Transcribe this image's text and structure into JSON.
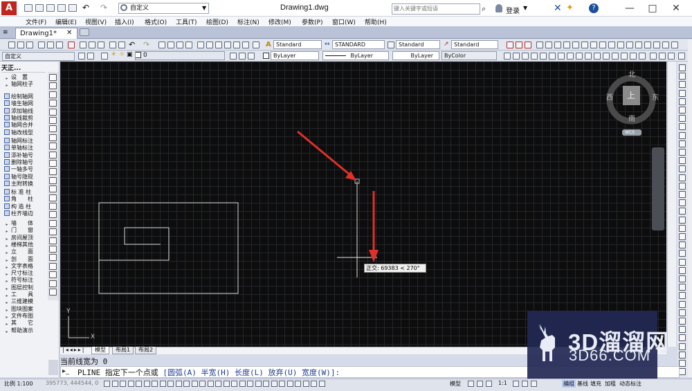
{
  "titlebar": {
    "workspace": "自定义",
    "title": "Drawing1.dwg",
    "search_placeholder": "键入关键字或短语",
    "login": "登录",
    "help": "?",
    "window_minimize": "—",
    "window_maximize": "□",
    "window_close": "✕"
  },
  "menu": [
    "文件(F)",
    "编辑(E)",
    "视图(V)",
    "插入(I)",
    "格式(O)",
    "工具(T)",
    "绘图(D)",
    "标注(N)",
    "修改(M)",
    "参数(P)",
    "窗口(W)",
    "帮助(H)"
  ],
  "tab": {
    "label": "Drawing1*",
    "close": "✕"
  },
  "toolbar1": {
    "text_style": "Standard",
    "dim_style": "STANDARD",
    "table_style": "Standard",
    "mleader_style": "Standard"
  },
  "toolbar2": {
    "workspace": "自定义",
    "layer": "0",
    "color": "ByLayer",
    "linetype": "ByLayer",
    "lineweight": "ByLayer",
    "plotstyle": "ByColor"
  },
  "palette": {
    "title": "天正...",
    "groups": [
      {
        "items": [
          "设　置",
          "轴网柱子"
        ]
      },
      {
        "items": [
          "绘制轴网",
          "墙生轴网",
          "添加轴线",
          "轴线裁剪",
          "轴网合并",
          "轴改线型"
        ]
      },
      {
        "items": [
          "轴网标注",
          "单轴标注",
          "添补轴号",
          "删除轴号",
          "一轴多号",
          "轴号隐现",
          "主附转换"
        ]
      },
      {
        "items": [
          "标 准 柱",
          "角　　柱",
          "构 造 柱",
          "柱齐墙边"
        ]
      },
      {
        "items": [
          "墙　　体",
          "门　　窗",
          "房间屋顶",
          "楼梯其他",
          "立　　面",
          "剖　　面",
          "文字表格",
          "尺寸标注",
          "符号标注",
          "图层控制",
          "工　　具",
          "三维建模",
          "图块图案",
          "文件布图",
          "其　　它",
          "帮助演示"
        ]
      }
    ]
  },
  "viewcube": {
    "north": "北",
    "south": "南",
    "east": "东",
    "west": "西",
    "face": "上",
    "ucs": "WCS"
  },
  "ucs_icon": {
    "y": "Y",
    "x": "X"
  },
  "tooltip": "正交: 69383 < 270°",
  "layout_tabs": [
    "模型",
    "布局1",
    "布局2"
  ],
  "command_history": "当前线宽为 0",
  "command_line": {
    "cmd": "PLINE",
    "prompt": "指定下一个点或",
    "options": [
      "[圆弧(A)",
      "半宽(H)",
      "长度(L)",
      "放弃(U)",
      "宽度(W)]:"
    ]
  },
  "statusbar": {
    "scale": "比例 1:100",
    "coords": "395773, 444544, 0",
    "model": "模型",
    "annot_scale": "1:1",
    "buttons": [
      "编组",
      "基线",
      "填充",
      "加粗",
      "动态标注"
    ]
  },
  "watermark": {
    "name": "3D溜溜网",
    "url": "3D66.COM"
  },
  "colors": {
    "canvas": "#0d0d0d",
    "grid": "#24262c",
    "arrow": "#e0302a",
    "geometry": "#d8d8d8"
  }
}
